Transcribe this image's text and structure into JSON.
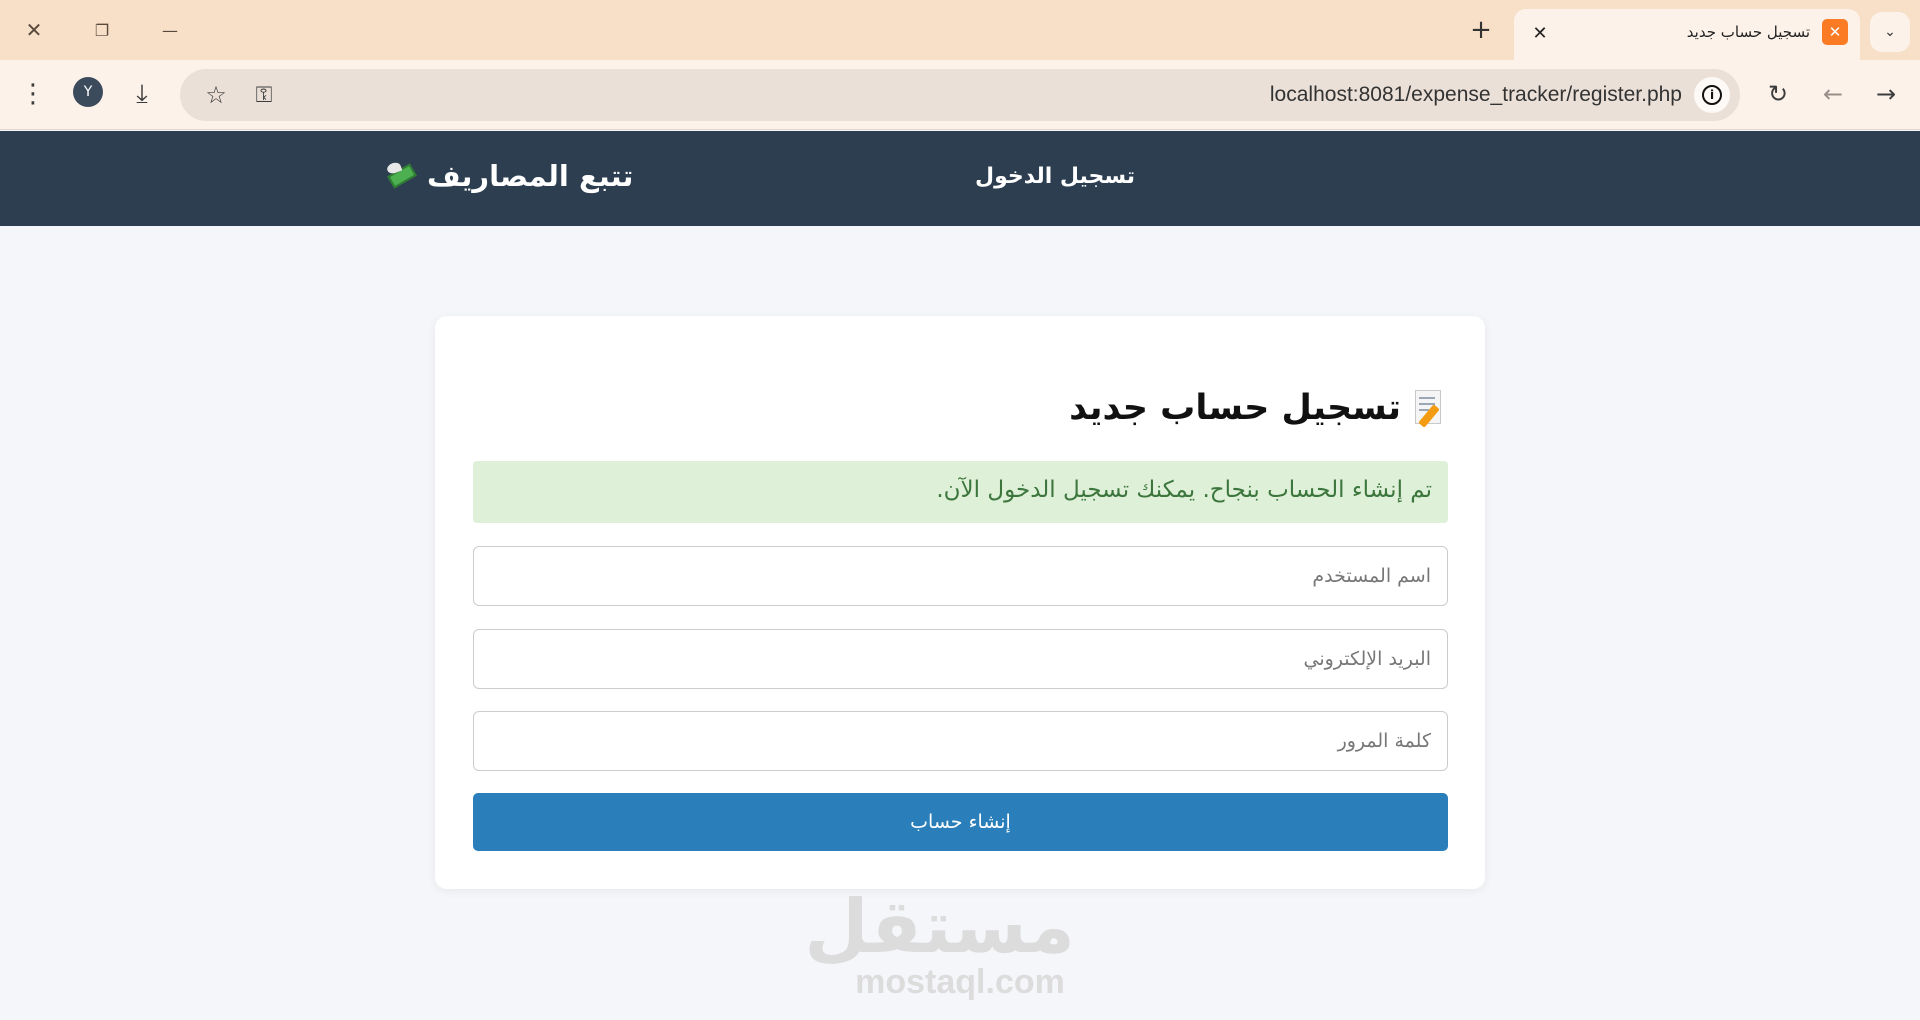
{
  "browser": {
    "tab": {
      "title": "تسجيل حساب جديد",
      "favicon": "xampp-icon",
      "close_label": "✕"
    },
    "new_tab_label": "+",
    "tab_search_label": "⌄",
    "window_controls": {
      "close": "✕",
      "restore": "❐",
      "minimize": "—"
    },
    "toolbar": {
      "avatar_initial": "Y",
      "url": "localhost:8081/expense_tracker/register.php",
      "site_info_label": "i",
      "menu_icon": "⋮",
      "download_icon": "⤓",
      "star_icon": "☆",
      "key_icon": "⚿",
      "reload_icon": "↻",
      "back_icon": "←",
      "forward_icon": "→"
    }
  },
  "header": {
    "brand": "تتبع المصاريف",
    "brand_icon": "money-with-wings-icon",
    "nav_login": "تسجيل الدخول",
    "bg_color": "#2c3e50"
  },
  "form": {
    "title": "تسجيل حساب جديد",
    "title_icon": "memo-icon",
    "success_message": "تم إنشاء الحساب بنجاح. يمكنك تسجيل الدخول الآن.",
    "username_placeholder": "اسم المستخدم",
    "email_placeholder": "البريد الإلكتروني",
    "password_placeholder": "كلمة المرور",
    "submit_label": "إنشاء حساب",
    "accent_color": "#2a7fba",
    "success_bg": "#dff0d8",
    "success_color": "#3c763d"
  },
  "watermark": {
    "arabic": "مستقل",
    "latin": "mostaql.com"
  }
}
